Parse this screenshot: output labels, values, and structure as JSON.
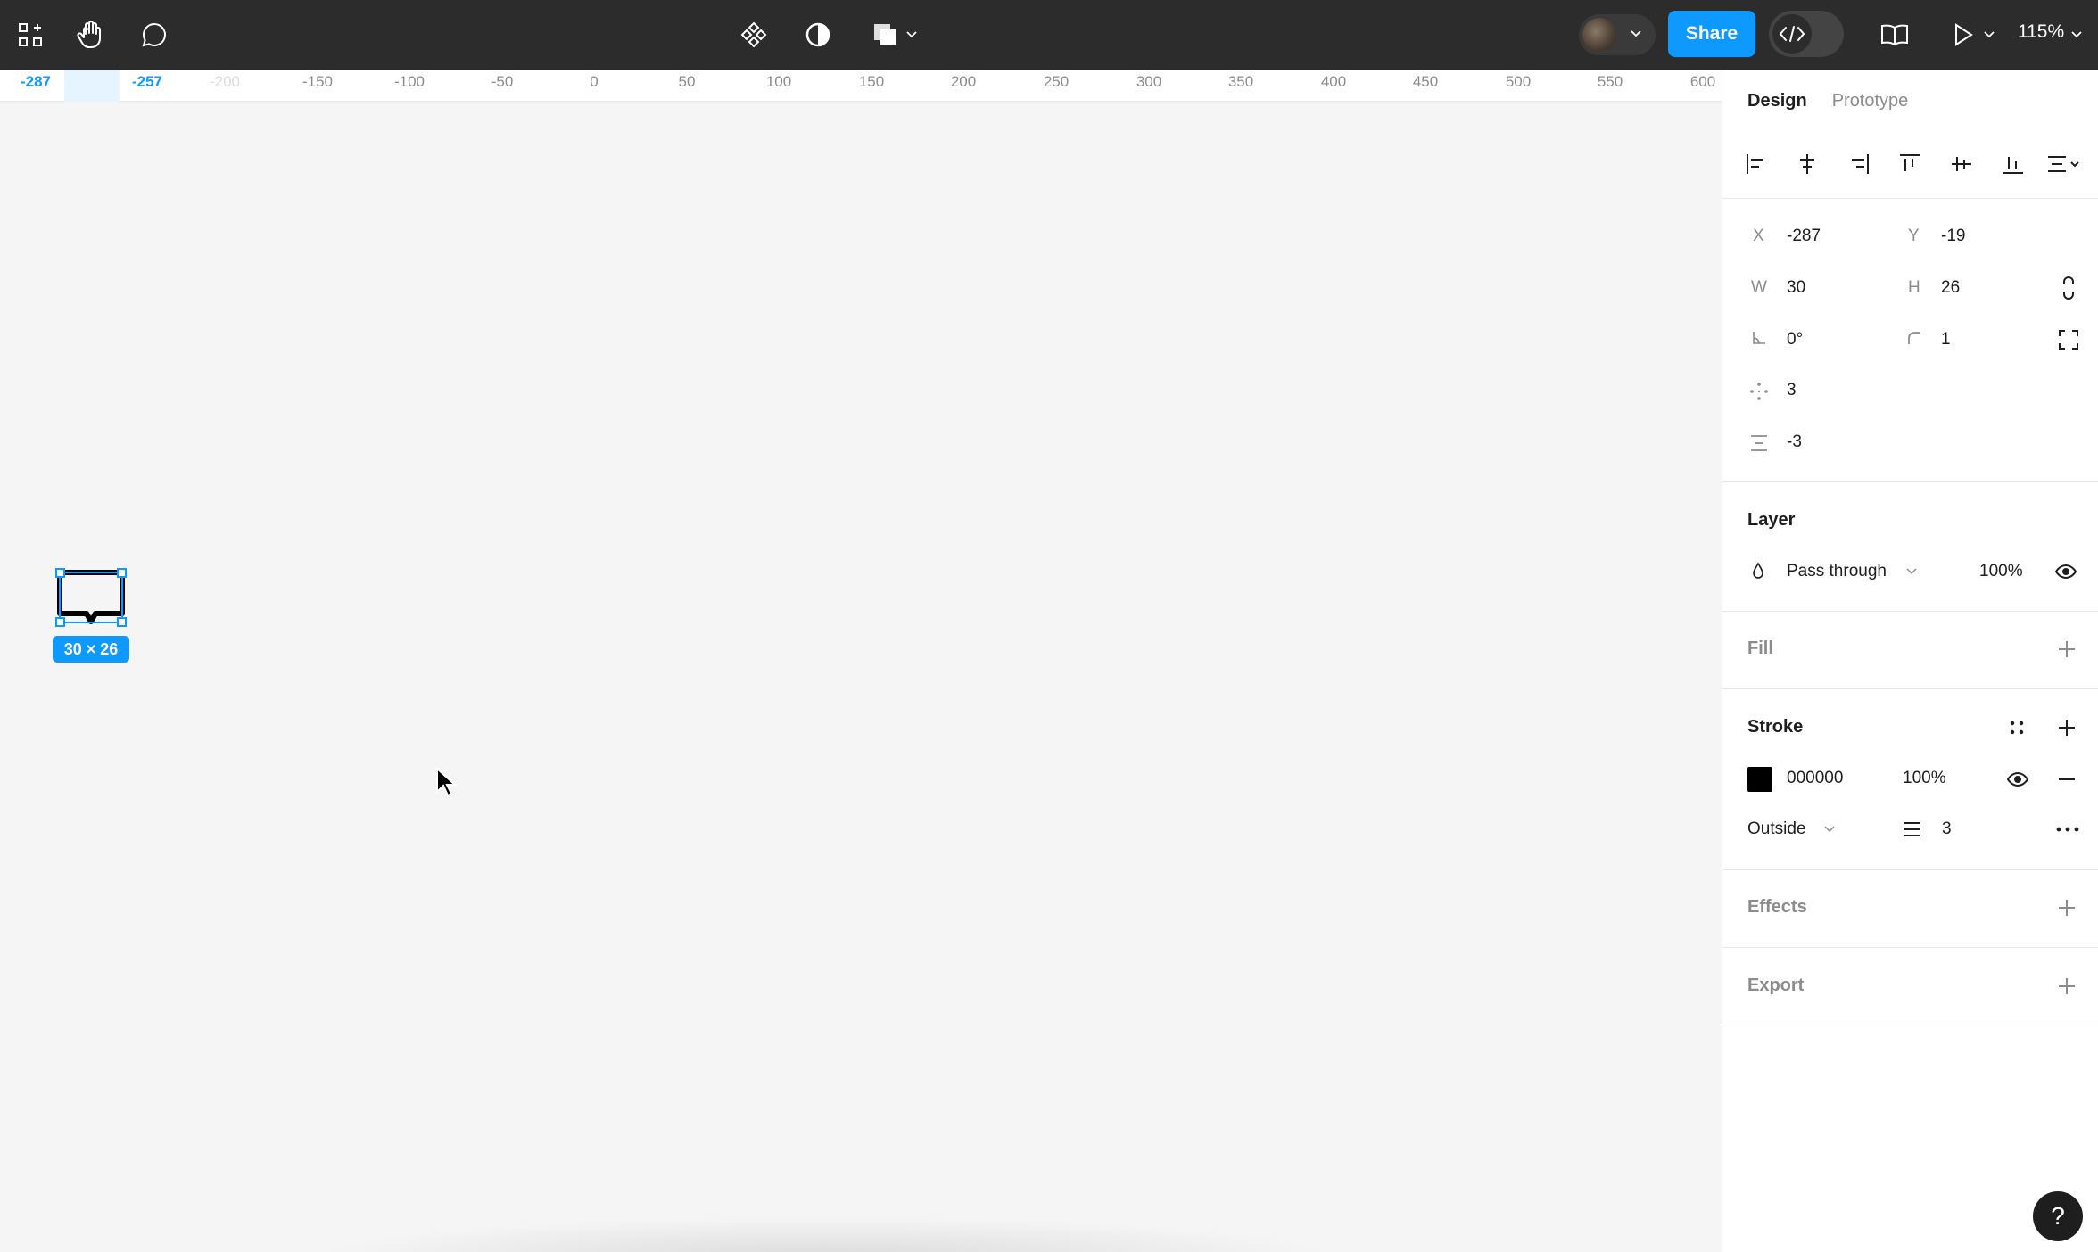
{
  "toolbar": {
    "share_label": "Share",
    "zoom_label": "115%",
    "icons": [
      "grid-menu-icon",
      "hand-icon",
      "comment-icon",
      "component-icon",
      "contrast-icon",
      "boolean-shapes-icon",
      "chevron-down-icon",
      "avatar",
      "dev-mode-icon",
      "library-icon",
      "play-icon"
    ]
  },
  "ruler": {
    "selection_start": "-287",
    "selection_end": "-257",
    "ticks": [
      "-200",
      "-150",
      "-100",
      "-50",
      "0",
      "50",
      "100",
      "150",
      "200",
      "250",
      "300",
      "350",
      "400",
      "450",
      "500",
      "550",
      "600"
    ]
  },
  "canvas": {
    "selection_size": "30 × 26"
  },
  "panel": {
    "tabs": [
      "Design",
      "Prototype"
    ],
    "x_label": "X",
    "x_value": "-287",
    "y_label": "Y",
    "y_value": "-19",
    "w_label": "W",
    "w_value": "30",
    "h_label": "H",
    "h_value": "26",
    "rotation_value": "0°",
    "radius_value": "1",
    "spacing_value": "3",
    "gap_value": "-3",
    "layer": {
      "title": "Layer",
      "blend_mode": "Pass through",
      "opacity": "100%"
    },
    "fill": {
      "title": "Fill"
    },
    "stroke": {
      "title": "Stroke",
      "color_hex": "000000",
      "opacity": "100%",
      "position": "Outside",
      "weight": "3",
      "swatch_color": "#000000"
    },
    "effects": {
      "title": "Effects"
    },
    "export": {
      "title": "Export"
    }
  },
  "help_label": "?"
}
